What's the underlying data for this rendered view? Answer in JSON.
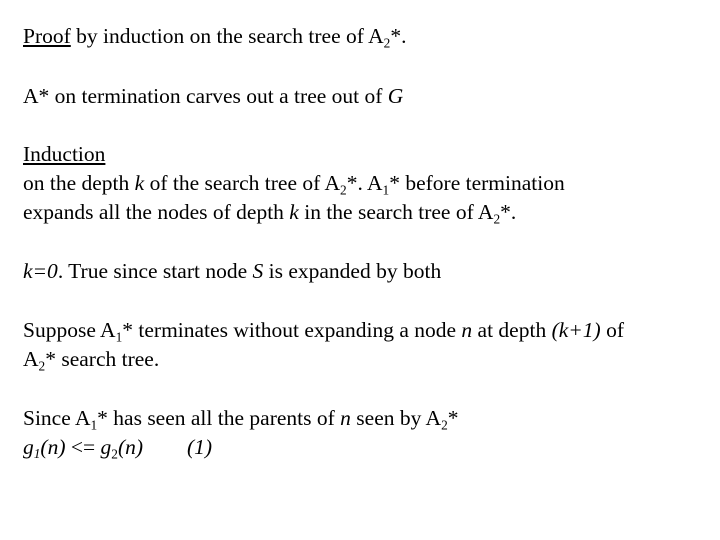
{
  "slide": {
    "p1": {
      "underlined": "Proof",
      "text": " by induction on the search tree of A",
      "sub": "2",
      "tail": "*."
    },
    "p2": {
      "text": "A* on termination carves out a tree out of ",
      "italic": "G"
    },
    "p3": {
      "heading": "Induction",
      "l1a": "on the depth ",
      "l1k": "k",
      "l1b": " of the search tree of A",
      "l1sub2": "2",
      "l1c": "*. A",
      "l1sub1": "1",
      "l1d": "* before termination",
      "l2a": "expands all the nodes of depth ",
      "l2k": "k",
      "l2b": " in the search tree of A",
      "l2sub": "2",
      "l2c": "*."
    },
    "p4": {
      "italic": "k=0",
      "text": ". True since start node ",
      "s": "S",
      "tail": " is expanded by both"
    },
    "p5": {
      "a": "Suppose A",
      "sub1": "1",
      "b": "* terminates without expanding a node ",
      "n": "n",
      "c": " at depth ",
      "k1": "(k+1)",
      "d": " of",
      "l2a": "A",
      "l2sub": "2",
      "l2b": "* search tree."
    },
    "p6": {
      "a": "Since A",
      "sub1": "1",
      "b": "* has seen all the parents of ",
      "n": "n",
      "c": " seen by A",
      "sub2": "2",
      "d": "*",
      "g1": "g",
      "g1sub": "1",
      "g1arg": "(n)",
      "op": " <= ",
      "g2": "g",
      "g2sub": "2",
      "g2arg": "(n)",
      "eqlabel": "(1)"
    }
  }
}
